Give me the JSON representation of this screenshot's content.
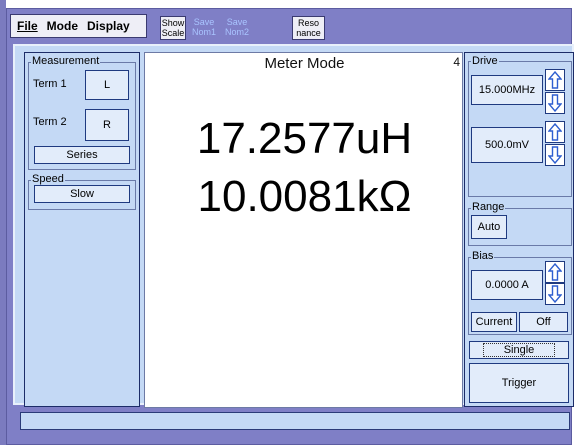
{
  "menu": {
    "file": "File",
    "mode": "Mode",
    "display": "Display"
  },
  "toolbar": {
    "show_scale_line1": "Show",
    "show_scale_line2": "Scale",
    "save_nom1_line1": "Save",
    "save_nom1_line2": "Nom1",
    "save_nom2_line1": "Save",
    "save_nom2_line2": "Nom2",
    "resonance_line1": "Reso",
    "resonance_line2": "nance"
  },
  "left_panel": {
    "measurement_title": "Measurement",
    "term1_label": "Term 1",
    "term1_value": "L",
    "term2_label": "Term 2",
    "term2_value": "R",
    "circuit_button": "Series",
    "speed_title": "Speed",
    "speed_button": "Slow"
  },
  "center": {
    "title": "Meter Mode",
    "indicator": "4",
    "reading1": "17.2577uH",
    "reading2": "10.0081kΩ"
  },
  "right_panel": {
    "drive_title": "Drive",
    "frequency": "15.000MHz",
    "voltage": "500.0mV",
    "range_title": "Range",
    "range_button": "Auto",
    "bias_title": "Bias",
    "bias_value": "0.0000 A",
    "current_button": "Current",
    "off_button": "Off",
    "single_button": "Single",
    "trigger_button": "Trigger"
  },
  "icons": {
    "up": "arrow-up-icon",
    "down": "arrow-down-icon"
  },
  "colors": {
    "accent": "#7f7fc6",
    "panel": "#c4d9f5",
    "arrow": "#2e5fd0"
  }
}
